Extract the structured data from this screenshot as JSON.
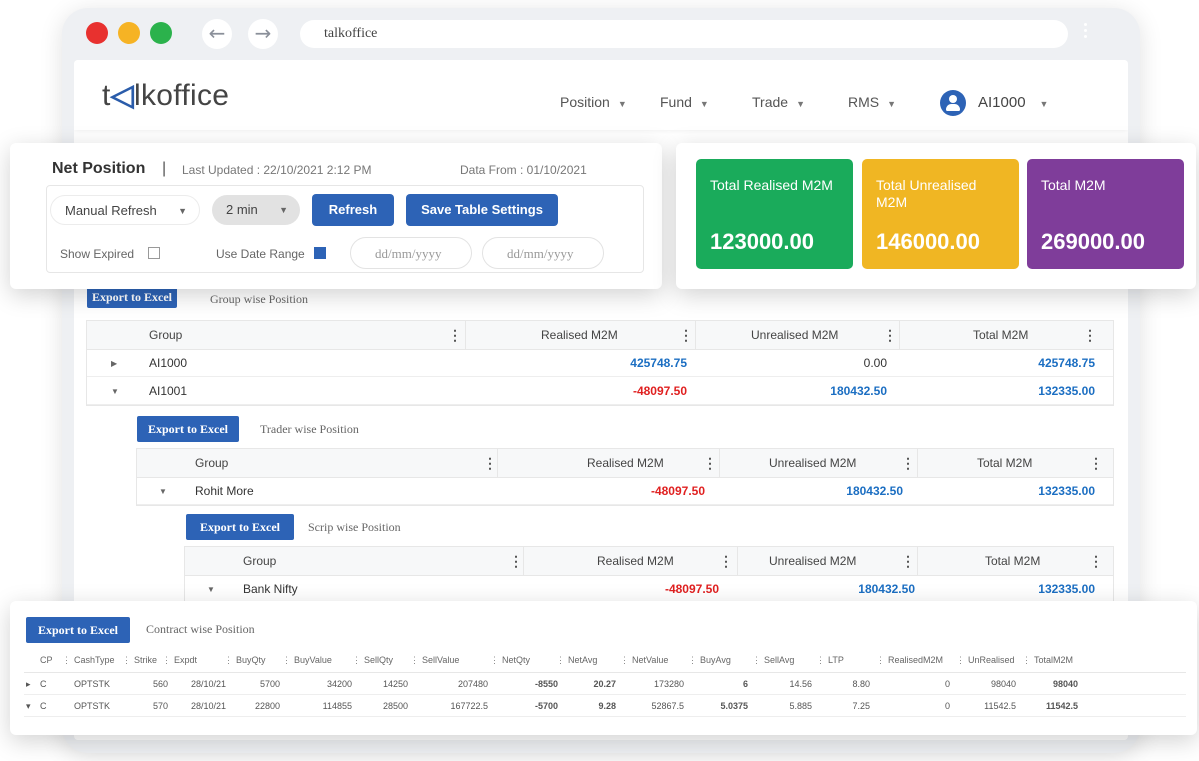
{
  "browser": {
    "url": "talkoffice",
    "dot_colors": [
      "#e8312f",
      "#f6b324",
      "#2bb24c"
    ]
  },
  "header": {
    "logo_pre": "t",
    "logo_accent": "◁",
    "logo_post": "lkoffice",
    "nav": [
      "Position",
      "Fund",
      "Trade",
      "RMS"
    ],
    "caret": "▼",
    "user": "AI1000"
  },
  "net_position": {
    "title": "Net Position",
    "separator": "|",
    "last_updated": "Last Updated : 22/10/2021  2:12 PM",
    "data_from": "Data From : 01/10/2021",
    "refresh_mode": "Manual Refresh",
    "interval": "2 min",
    "refresh_label": "Refresh",
    "save_settings_label": "Save Table Settings",
    "show_expired_label": "Show Expired",
    "show_expired": false,
    "use_date_range_label": "Use Date Range",
    "use_date_range": true,
    "date_from_placeholder": "dd/mm/yyyy",
    "date_to_placeholder": "dd/mm/yyyy"
  },
  "totals": [
    {
      "label": "Total Realised M2M",
      "value": "123000.00",
      "color": "#1aab5b"
    },
    {
      "label": "Total Unrealised M2M",
      "value": "146000.00",
      "color": "#f0b623"
    },
    {
      "label": "Total M2M",
      "value": "269000.00",
      "color": "#7f3d9a"
    }
  ],
  "export_label": "Export to Excel",
  "group_table": {
    "caption": "Group wise Position",
    "headers": [
      "Group",
      "Realised M2M",
      "Unrealised M2M",
      "Total M2M"
    ],
    "rows": [
      {
        "expander": "▶",
        "group": "AI1000",
        "realised": "425748.75",
        "unrealised": "0.00",
        "total": "425748.75"
      },
      {
        "expander": "▼",
        "group": "AI1001",
        "realised": "-48097.50",
        "unrealised": "180432.50",
        "total": "132335.00"
      }
    ]
  },
  "trader_table": {
    "caption": "Trader wise Position",
    "headers": [
      "Group",
      "Realised M2M",
      "Unrealised M2M",
      "Total M2M"
    ],
    "rows": [
      {
        "expander": "▼",
        "group": "Rohit More",
        "realised": "-48097.50",
        "unrealised": "180432.50",
        "total": "132335.00"
      }
    ]
  },
  "scrip_table": {
    "caption": "Scrip wise Position",
    "headers": [
      "Group",
      "Realised M2M",
      "Unrealised M2M",
      "Total M2M"
    ],
    "rows": [
      {
        "expander": "▼",
        "group": "Bank Nifty",
        "realised": "-48097.50",
        "unrealised": "180432.50",
        "total": "132335.00"
      }
    ]
  },
  "contract_table": {
    "caption": "Contract wise Position",
    "headers": [
      "CP",
      "CashType",
      "Strike",
      "Expdt",
      "BuyQty",
      "BuyValue",
      "SellQty",
      "SellValue",
      "NetQty",
      "NetAvg",
      "NetValue",
      "BuyAvg",
      "SellAvg",
      "LTP",
      "RealisedM2M",
      "UnRealised",
      "TotalM2M"
    ],
    "rows": [
      {
        "expander": "▸",
        "cells": [
          "C",
          "OPTSTK",
          "560",
          "28/10/21",
          "5700",
          "34200",
          "14250",
          "207480",
          "-8550",
          "20.27",
          "173280",
          "6",
          "14.56",
          "8.80",
          "0",
          "98040",
          "98040"
        ]
      },
      {
        "expander": "▾",
        "cells": [
          "C",
          "OPTSTK",
          "570",
          "28/10/21",
          "22800",
          "114855",
          "28500",
          "167722.5",
          "-5700",
          "9.28",
          "52867.5",
          "5.0375",
          "5.885",
          "7.25",
          "0",
          "11542.5",
          "11542.5"
        ]
      }
    ]
  },
  "column_menu_glyph": "⋮"
}
